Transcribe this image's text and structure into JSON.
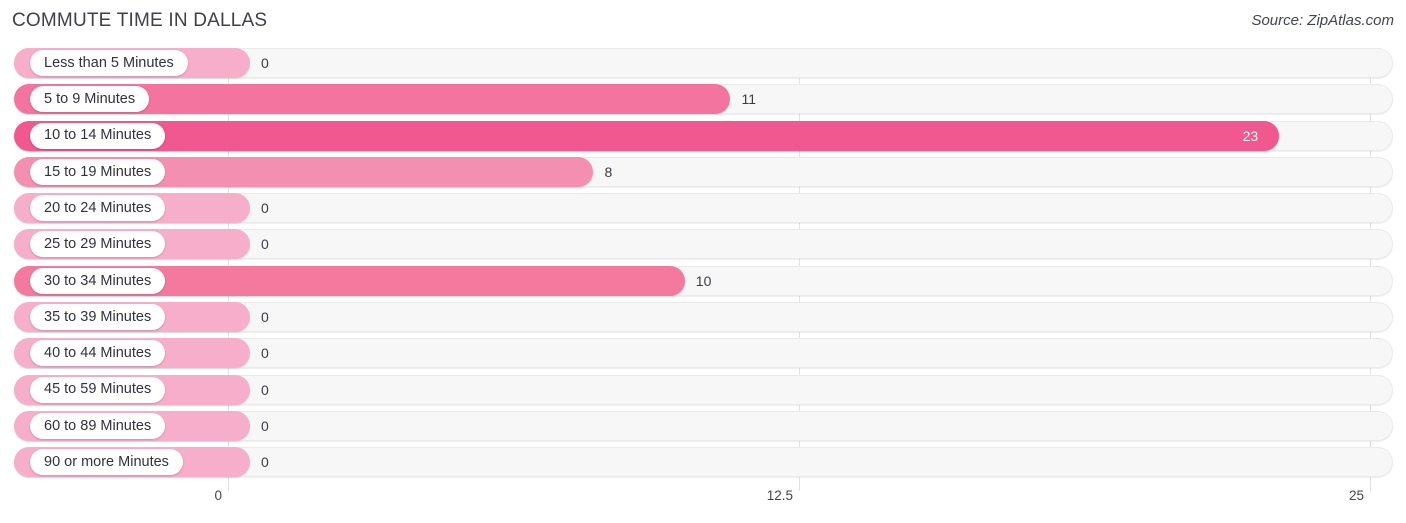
{
  "header": {
    "title": "COMMUTE TIME IN DALLAS",
    "source": "Source: ZipAtlas.com"
  },
  "colors": {
    "bar_zero": "#f7aecb",
    "bar_mid": "#f2749f",
    "bar_high": "#f0588f",
    "track": "#f7f7f7",
    "gridline": "#e3e3e6",
    "text": "#3b3b4a"
  },
  "axis": {
    "ticks": [
      "0",
      "12.5",
      "25"
    ],
    "min": 0,
    "max": 25
  },
  "chart_data": {
    "type": "bar",
    "orientation": "horizontal",
    "title": "COMMUTE TIME IN DALLAS",
    "subtitle": "Source: ZipAtlas.com",
    "xlabel": "",
    "ylabel": "",
    "xlim": [
      0,
      25
    ],
    "xticks": [
      0,
      12.5,
      25
    ],
    "grid": true,
    "legend": false,
    "categories": [
      "Less than 5 Minutes",
      "5 to 9 Minutes",
      "10 to 14 Minutes",
      "15 to 19 Minutes",
      "20 to 24 Minutes",
      "25 to 29 Minutes",
      "30 to 34 Minutes",
      "35 to 39 Minutes",
      "40 to 44 Minutes",
      "45 to 59 Minutes",
      "60 to 89 Minutes",
      "90 or more Minutes"
    ],
    "values": [
      0,
      11,
      23,
      8,
      0,
      0,
      10,
      0,
      0,
      0,
      0,
      0
    ],
    "value_labels": [
      "0",
      "11",
      "23",
      "8",
      "0",
      "0",
      "10",
      "0",
      "0",
      "0",
      "0",
      "0"
    ]
  },
  "rows": [
    {
      "label": "Less than 5 Minutes",
      "value": 0,
      "value_label": "0",
      "bar_color": "#f7aecb",
      "label_inside": false
    },
    {
      "label": "5 to 9 Minutes",
      "value": 11,
      "value_label": "11",
      "bar_color": "#f2749f",
      "label_inside": false
    },
    {
      "label": "10 to 14 Minutes",
      "value": 23,
      "value_label": "23",
      "bar_color": "#f0588f",
      "label_inside": true
    },
    {
      "label": "15 to 19 Minutes",
      "value": 8,
      "value_label": "8",
      "bar_color": "#f48fb2",
      "label_inside": false
    },
    {
      "label": "20 to 24 Minutes",
      "value": 0,
      "value_label": "0",
      "bar_color": "#f7aecb",
      "label_inside": false
    },
    {
      "label": "25 to 29 Minutes",
      "value": 0,
      "value_label": "0",
      "bar_color": "#f7aecb",
      "label_inside": false
    },
    {
      "label": "30 to 34 Minutes",
      "value": 10,
      "value_label": "10",
      "bar_color": "#f4799f",
      "label_inside": false
    },
    {
      "label": "35 to 39 Minutes",
      "value": 0,
      "value_label": "0",
      "bar_color": "#f7aecb",
      "label_inside": false
    },
    {
      "label": "40 to 44 Minutes",
      "value": 0,
      "value_label": "0",
      "bar_color": "#f7aecb",
      "label_inside": false
    },
    {
      "label": "45 to 59 Minutes",
      "value": 0,
      "value_label": "0",
      "bar_color": "#f7aecb",
      "label_inside": false
    },
    {
      "label": "60 to 89 Minutes",
      "value": 0,
      "value_label": "0",
      "bar_color": "#f7aecb",
      "label_inside": false
    },
    {
      "label": "90 or more Minutes",
      "value": 0,
      "value_label": "0",
      "bar_color": "#f7aecb",
      "label_inside": false
    }
  ]
}
